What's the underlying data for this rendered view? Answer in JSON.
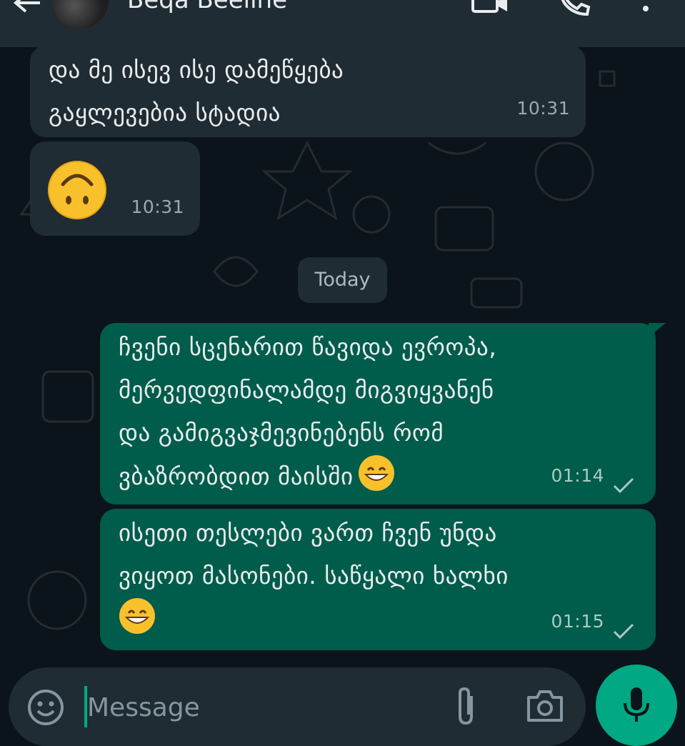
{
  "header": {
    "contact_name": "Beqa Beeline"
  },
  "messages": [
    {
      "direction": "in",
      "text": "და მე ისევ ისე დამეწყება\nგაყლევებია სტადია",
      "time": "10:31"
    },
    {
      "direction": "in",
      "emoji": "upside-down-face",
      "time": "10:31"
    },
    {
      "direction": "out",
      "text": "ჩვენი სცენარით წავიდა ევროპა,\nმერვედფინალამდე მიგვიყვანენ\nდა გამიგვაჯმევინებენს რომ\nვბაზრობდით მაისში",
      "emoji": "grinning-face",
      "time": "01:14",
      "status": "sent"
    },
    {
      "direction": "out",
      "text": "ისეთი თესლები ვართ ჩვენ უნდა\nვიყოთ მასონები. საწყალი ხალხი",
      "emoji": "grinning-face",
      "time": "01:15",
      "status": "sent"
    }
  ],
  "date_divider": "Today",
  "composer": {
    "placeholder": "Message"
  },
  "icons": [
    "back-arrow-icon",
    "avatar",
    "video-call-icon",
    "voice-call-icon",
    "more-options-icon",
    "emoji-icon",
    "attach-icon",
    "camera-icon",
    "mic-icon"
  ],
  "colors": {
    "background": "#0b141a",
    "incoming_bubble": "#202c33",
    "outgoing_bubble": "#005c4b",
    "accent": "#00a884"
  }
}
